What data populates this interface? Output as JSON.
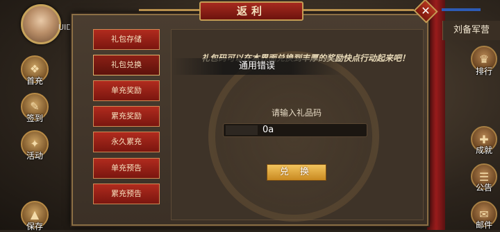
{
  "player": {
    "uid_label": "UID"
  },
  "dialog": {
    "title": "返利",
    "close_symbol": "✕",
    "menu": [
      {
        "label": "礼包存储"
      },
      {
        "label": "礼包兑换"
      },
      {
        "label": "单充奖励"
      },
      {
        "label": "累充奖励"
      },
      {
        "label": "永久累充"
      },
      {
        "label": "单充预告"
      },
      {
        "label": "累充预告"
      }
    ],
    "active_menu": "礼包兑换",
    "description": "礼包码可以在本界面兑换到丰厚的奖励快点行动起来吧！",
    "toast": "通用错误",
    "prompt": "请输入礼品码",
    "code_value": "0a",
    "redeem_label": "兑 换"
  },
  "left_side": [
    {
      "label": "首充",
      "icon": "gift-icon"
    },
    {
      "label": "签到",
      "icon": "checkin-icon"
    },
    {
      "label": "活动",
      "icon": "event-icon"
    },
    {
      "label": "保存",
      "icon": "save-icon"
    }
  ],
  "right_side": {
    "tab_label": "刘备军营",
    "buttons": [
      {
        "label": "排行",
        "icon": "ranking-icon"
      },
      {
        "label": "成就",
        "icon": "achievement-icon"
      },
      {
        "label": "公告",
        "icon": "announcement-icon"
      },
      {
        "label": "邮件",
        "icon": "mail-icon"
      }
    ]
  },
  "colors": {
    "accent_red": "#a62a1f",
    "gold": "#c59c54",
    "button_gold": "#e2a93a"
  }
}
